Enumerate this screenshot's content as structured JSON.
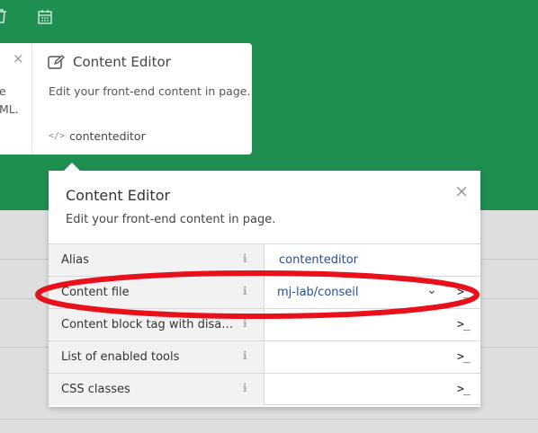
{
  "toolbar": {
    "icons": [
      "trash-icon",
      "calendar-icon"
    ]
  },
  "left_card": {
    "close": "×",
    "fragments": [
      "e",
      "ML."
    ]
  },
  "card": {
    "title": "Content Editor",
    "description": "Edit your front-end content in page.",
    "alias_icon": "</>",
    "alias": "contenteditor"
  },
  "popover": {
    "title": "Content Editor",
    "description": "Edit your front-end content in page.",
    "close": "×",
    "info_glyph": "i",
    "rows": [
      {
        "label": "Alias",
        "value": "contenteditor"
      },
      {
        "label": "Content file",
        "value": "mj-lab/conseil",
        "dropdown": true
      },
      {
        "label": "Content block tag with disabi...",
        "value": ""
      },
      {
        "label": "List of enabled tools",
        "value": ""
      },
      {
        "label": "CSS classes",
        "value": ""
      }
    ],
    "terminal_glyph": ">_",
    "chevron_glyph": "⌄"
  },
  "colors": {
    "header": "#1e8f50",
    "highlight": "#e8101a",
    "link": "#2a4d8f"
  }
}
